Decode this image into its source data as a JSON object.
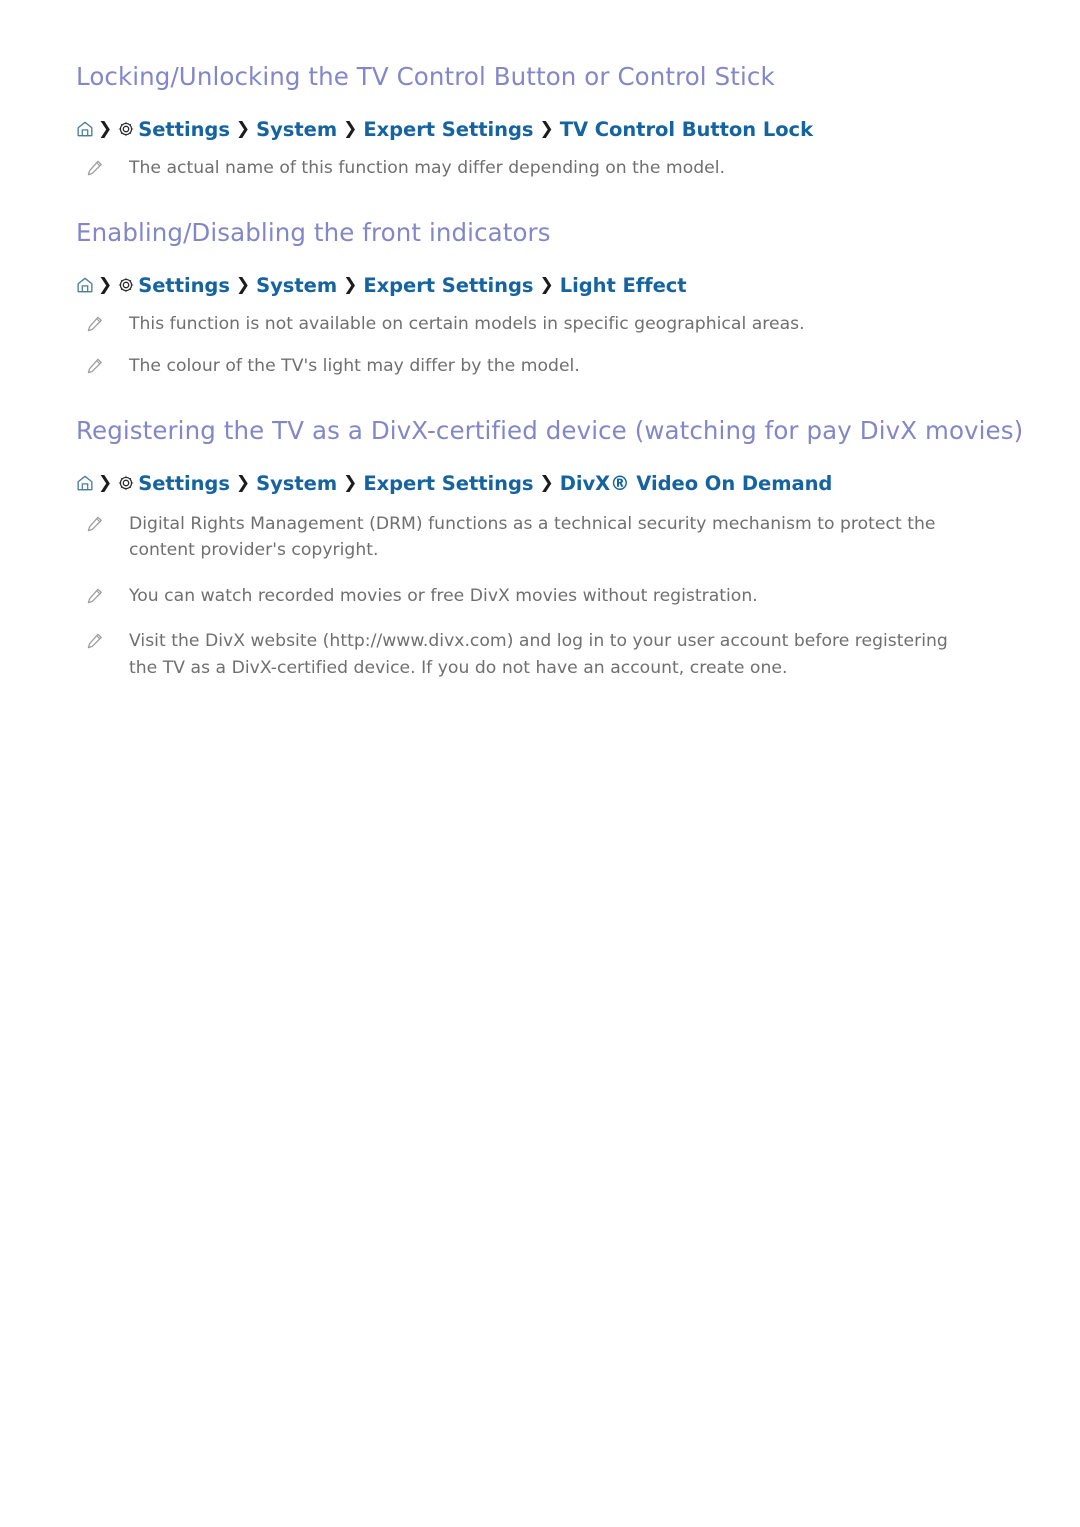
{
  "document": {
    "background_color": "#ffffff",
    "heading_color": "#8387c8",
    "breadcrumb_color": "#15639f",
    "body_text_color": "#6f6f6f",
    "separator_color": "#1c1c1c"
  },
  "sections": [
    {
      "heading": "Locking/Unlocking the TV Control Button or Control Stick",
      "breadcrumb": {
        "home_icon": "home-icon",
        "gear_icon": "gear-icon",
        "separator": "❯",
        "items": [
          "Settings",
          "System",
          "Expert Settings",
          "TV Control Button Lock"
        ]
      },
      "notes": [
        "The actual name of this function may differ depending on the model."
      ]
    },
    {
      "heading": "Enabling/Disabling the front indicators",
      "breadcrumb": {
        "home_icon": "home-icon",
        "gear_icon": "gear-icon",
        "separator": "❯",
        "items": [
          "Settings",
          "System",
          "Expert Settings",
          "Light Effect"
        ]
      },
      "notes": [
        "This function is not available on certain models in specific geographical areas.",
        "The colour of the TV's light may differ by the model."
      ]
    },
    {
      "heading": "Registering the TV as a DivX-certified device (watching for pay DivX movies)",
      "breadcrumb": {
        "home_icon": "home-icon",
        "gear_icon": "gear-icon",
        "separator": "❯",
        "items": [
          "Settings",
          "System",
          "Expert Settings",
          "DivX® Video On Demand"
        ]
      },
      "notes": [
        "Digital Rights Management (DRM) functions as a technical security mechanism to protect the content provider's copyright.",
        "You can watch recorded movies or free DivX movies without registration.",
        "Visit the DivX website (http://www.divx.com) and log in to your user account before registering the TV as a DivX-certified device. If you do not have an account, create one."
      ]
    }
  ]
}
